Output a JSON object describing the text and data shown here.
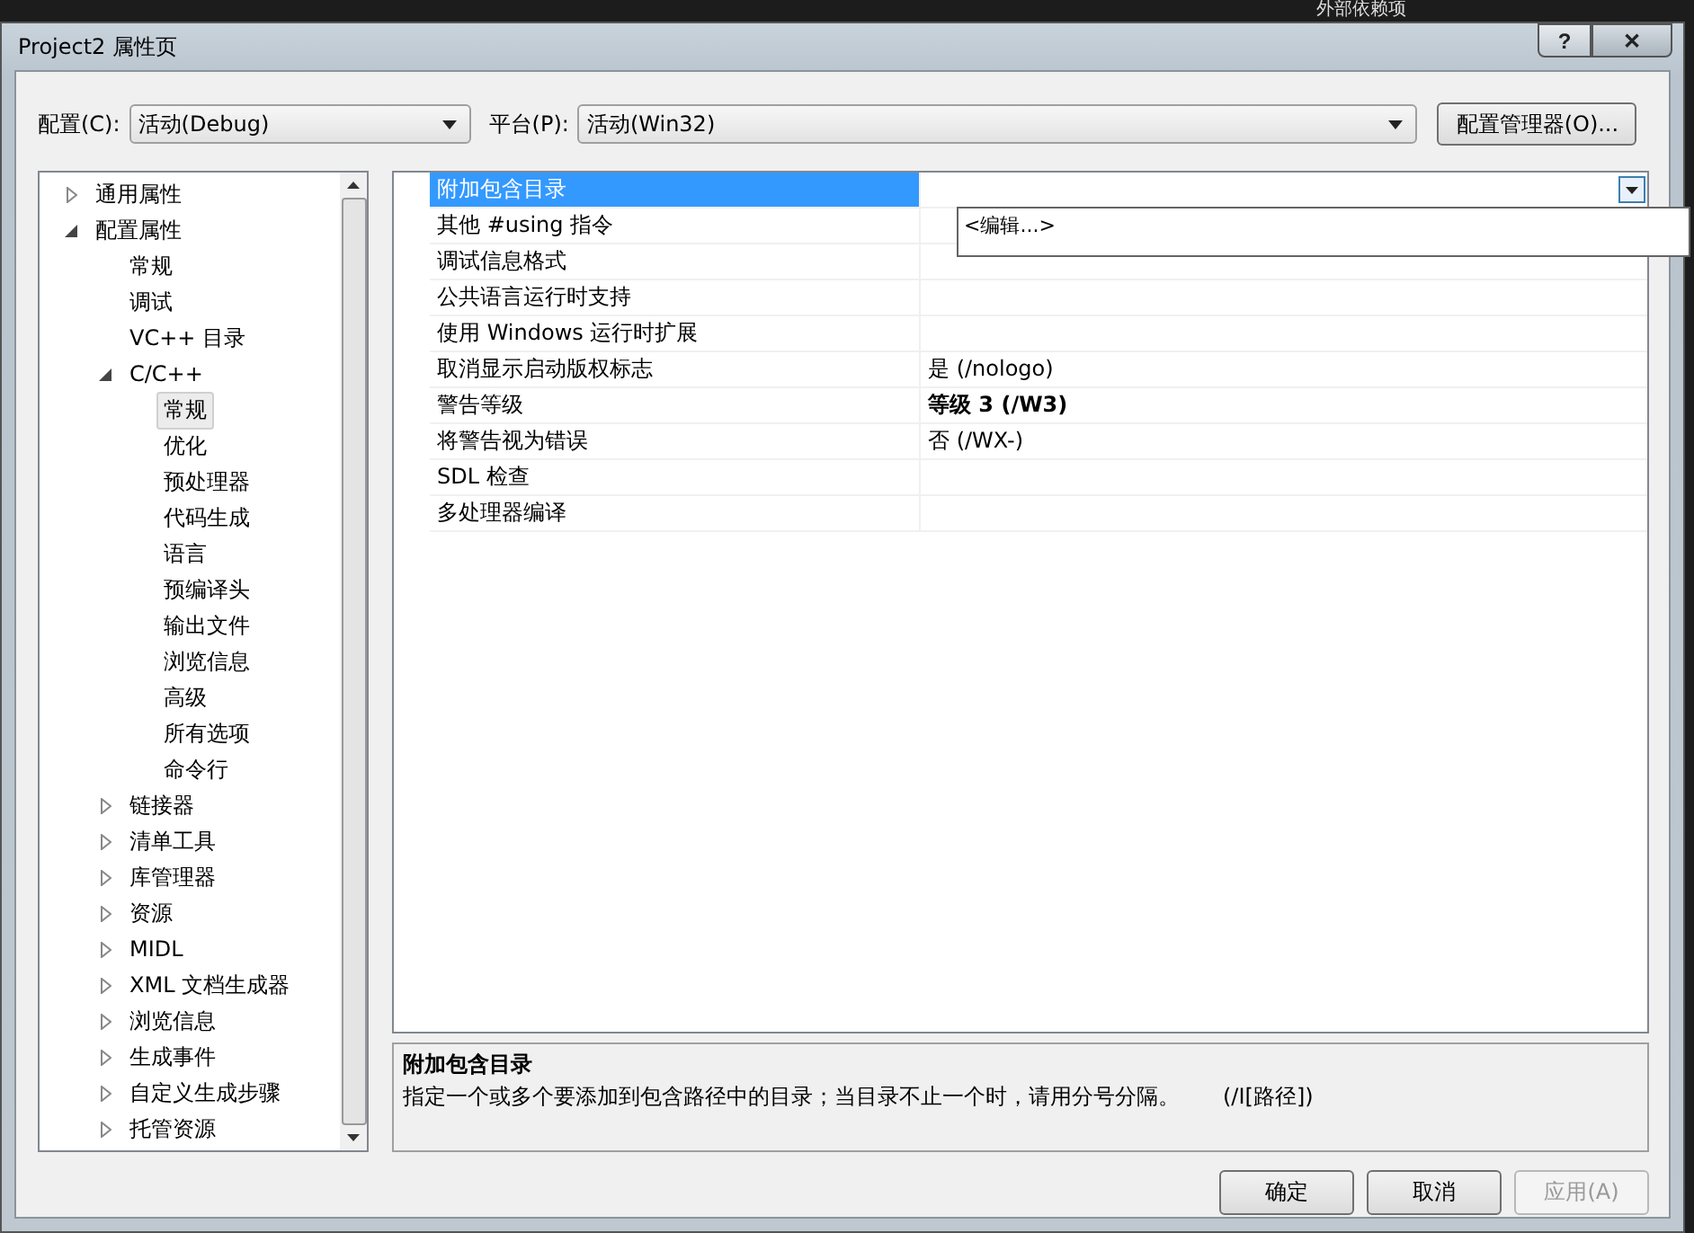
{
  "background": {
    "item": "外部依赖项"
  },
  "window": {
    "title": "Project2 属性页",
    "help_button": "?",
    "close_button": "✕"
  },
  "config_bar": {
    "config_label": "配置(C):",
    "config_value": "活动(Debug)",
    "platform_label": "平台(P):",
    "platform_value": "活动(Win32)",
    "manager_button": "配置管理器(O)..."
  },
  "tree": [
    {
      "label": "通用属性",
      "expanded": false,
      "selected": false
    },
    {
      "label": "配置属性",
      "expanded": true,
      "selected": false,
      "children": [
        {
          "label": "常规",
          "selected": false
        },
        {
          "label": "调试",
          "selected": false
        },
        {
          "label": "VC++ 目录",
          "selected": false
        },
        {
          "label": "C/C++",
          "expanded": true,
          "selected": false,
          "children": [
            {
              "label": "常规",
              "selected": true
            },
            {
              "label": "优化",
              "selected": false
            },
            {
              "label": "预处理器",
              "selected": false
            },
            {
              "label": "代码生成",
              "selected": false
            },
            {
              "label": "语言",
              "selected": false
            },
            {
              "label": "预编译头",
              "selected": false
            },
            {
              "label": "输出文件",
              "selected": false
            },
            {
              "label": "浏览信息",
              "selected": false
            },
            {
              "label": "高级",
              "selected": false
            },
            {
              "label": "所有选项",
              "selected": false
            },
            {
              "label": "命令行",
              "selected": false
            }
          ]
        },
        {
          "label": "链接器",
          "expanded": false,
          "selected": false
        },
        {
          "label": "清单工具",
          "expanded": false,
          "selected": false
        },
        {
          "label": "库管理器",
          "expanded": false,
          "selected": false
        },
        {
          "label": "资源",
          "expanded": false,
          "selected": false
        },
        {
          "label": "MIDL",
          "expanded": false,
          "selected": false
        },
        {
          "label": "XML 文档生成器",
          "expanded": false,
          "selected": false
        },
        {
          "label": "浏览信息",
          "expanded": false,
          "selected": false
        },
        {
          "label": "生成事件",
          "expanded": false,
          "selected": false
        },
        {
          "label": "自定义生成步骤",
          "expanded": false,
          "selected": false
        },
        {
          "label": "托管资源",
          "expanded": false,
          "selected": false
        }
      ]
    }
  ],
  "properties": [
    {
      "name": "附加包含目录",
      "selected": true
    },
    {
      "name": "其他 #using 指令",
      "selected": false
    },
    {
      "name": "调试信息格式",
      "selected": false
    },
    {
      "name": "公共语言运行时支持",
      "selected": false
    },
    {
      "name": "使用 Windows 运行时扩展",
      "selected": false
    },
    {
      "name": "取消显示启动版权标志",
      "value": "是 (/nologo)",
      "selected": false
    },
    {
      "name": "警告等级",
      "value": "等级 3 (/W3)",
      "bold": true,
      "selected": false
    },
    {
      "name": "将警告视为错误",
      "value": "否 (/WX-)",
      "selected": false
    },
    {
      "name": "SDL 检查",
      "selected": false
    },
    {
      "name": "多处理器编译",
      "selected": false
    }
  ],
  "dropdown": {
    "options": [
      "<编辑...>"
    ]
  },
  "description": {
    "title": "附加包含目录",
    "text": "指定一个或多个要添加到包含路径中的目录；当目录不止一个时，请用分号分隔。",
    "switch": "(/I[路径])"
  },
  "buttons": [
    {
      "label": "确定",
      "disabled": false
    },
    {
      "label": "取消",
      "disabled": false
    },
    {
      "label": "应用(A)",
      "disabled": true
    }
  ]
}
